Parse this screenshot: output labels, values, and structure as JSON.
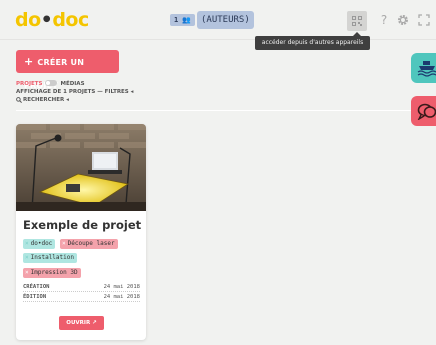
{
  "header": {
    "logo_part1": "do",
    "logo_dot": "•",
    "logo_part2": "doc",
    "authors_count": "1 👥",
    "authors_label": "(AUTEURS)",
    "help_label": "?",
    "tooltip": "accéder depuis d'autres appareils"
  },
  "toolbar": {
    "create_label": "CRÉER UN PROJET",
    "create_icon": "+",
    "projects_label": "PROJETS",
    "media_label": "MÉDIAS",
    "display_label": "AFFICHAGE DE 1 PROJETS — FILTRES ◂",
    "search_label": "RECHERCHER ◂"
  },
  "project": {
    "title": "Exemple de projet",
    "tags": [
      {
        "label": "do•doc",
        "color": "teal"
      },
      {
        "label": "Découpe laser",
        "color": "red"
      },
      {
        "label": "Installation",
        "color": "teal"
      },
      {
        "label": "Impression 3D",
        "color": "red"
      }
    ],
    "tag_remove": "×",
    "created_label": "CRÉATION",
    "created_value": "24 mai 2018",
    "edited_label": "ÉDITION",
    "edited_value": "24 mai 2018",
    "open_label": "OUVRIR ↗"
  },
  "colors": {
    "accent_red": "#ee5d6c",
    "accent_teal": "#4fc6bd",
    "logo_yellow": "#f4c500",
    "authors_blue": "#b3c3dd"
  },
  "icons": {
    "qr": "qr-code-icon",
    "help": "help-icon",
    "settings": "gear-icon",
    "fullscreen": "fullscreen-icon",
    "side_top": "boat-icon",
    "side_bottom": "chat-icon"
  }
}
